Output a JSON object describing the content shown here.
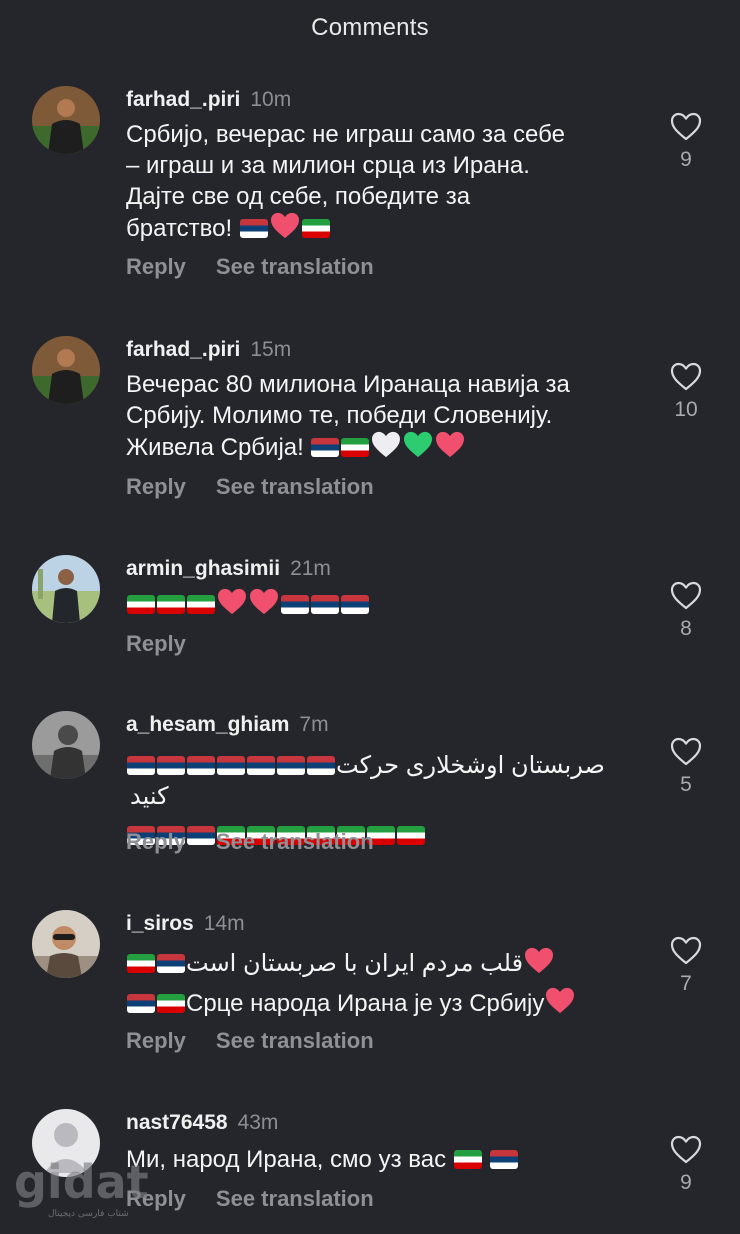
{
  "header": {
    "title": "Comments"
  },
  "actions": {
    "reply_label": "Reply",
    "translate_label": "See translation"
  },
  "comments": [
    {
      "username": "farhad_.piri",
      "time": "10m",
      "lines": [
        "Србијо, вечерас не играш само за себе",
        "– играш и за милион срца из Ирана.",
        "Дајте све од себе, победите за",
        "братство!"
      ],
      "likes": "9"
    },
    {
      "username": "farhad_.piri",
      "time": "15m",
      "lines": [
        "Вечерас 80 милиона Иранаца навија за",
        "Србију. Молимо те, победи Словенију.",
        "Живела Србија!"
      ],
      "likes": "10"
    },
    {
      "username": "armin_ghasimii",
      "time": "21m",
      "lines": [],
      "likes": "8"
    },
    {
      "username": "a_hesam_ghiam",
      "time": "7m",
      "lines": [
        "صربستان اوشخلاری حرکت کنید"
      ],
      "likes": "5"
    },
    {
      "username": "i_siros",
      "time": "14m",
      "lines": [
        "قلب مردم ایران با صربستان است",
        "Срце народа Ирана је уз Србију"
      ],
      "likes": "7"
    },
    {
      "username": "nast76458",
      "time": "43m",
      "lines": [
        "Ми, народ Ирана, смо уз вас"
      ],
      "likes": "9"
    }
  ],
  "watermark": {
    "text": "gidat",
    "subtitle": "شتاب فارسی دیجیتال"
  },
  "colors": {
    "background": "#25262b",
    "muted": "#8f9096",
    "heart_emoji": "#f0506e",
    "green_heart": "#2ecc71",
    "serbia_red": "#c6363c",
    "serbia_blue": "#0c4076",
    "iran_green": "#239f40",
    "iran_red": "#da0000"
  },
  "icons": {
    "like": "heart-outline-icon",
    "emoji_heart": "red-heart-emoji",
    "flag_rs": "serbia-flag-emoji",
    "flag_ir": "iran-flag-emoji"
  }
}
